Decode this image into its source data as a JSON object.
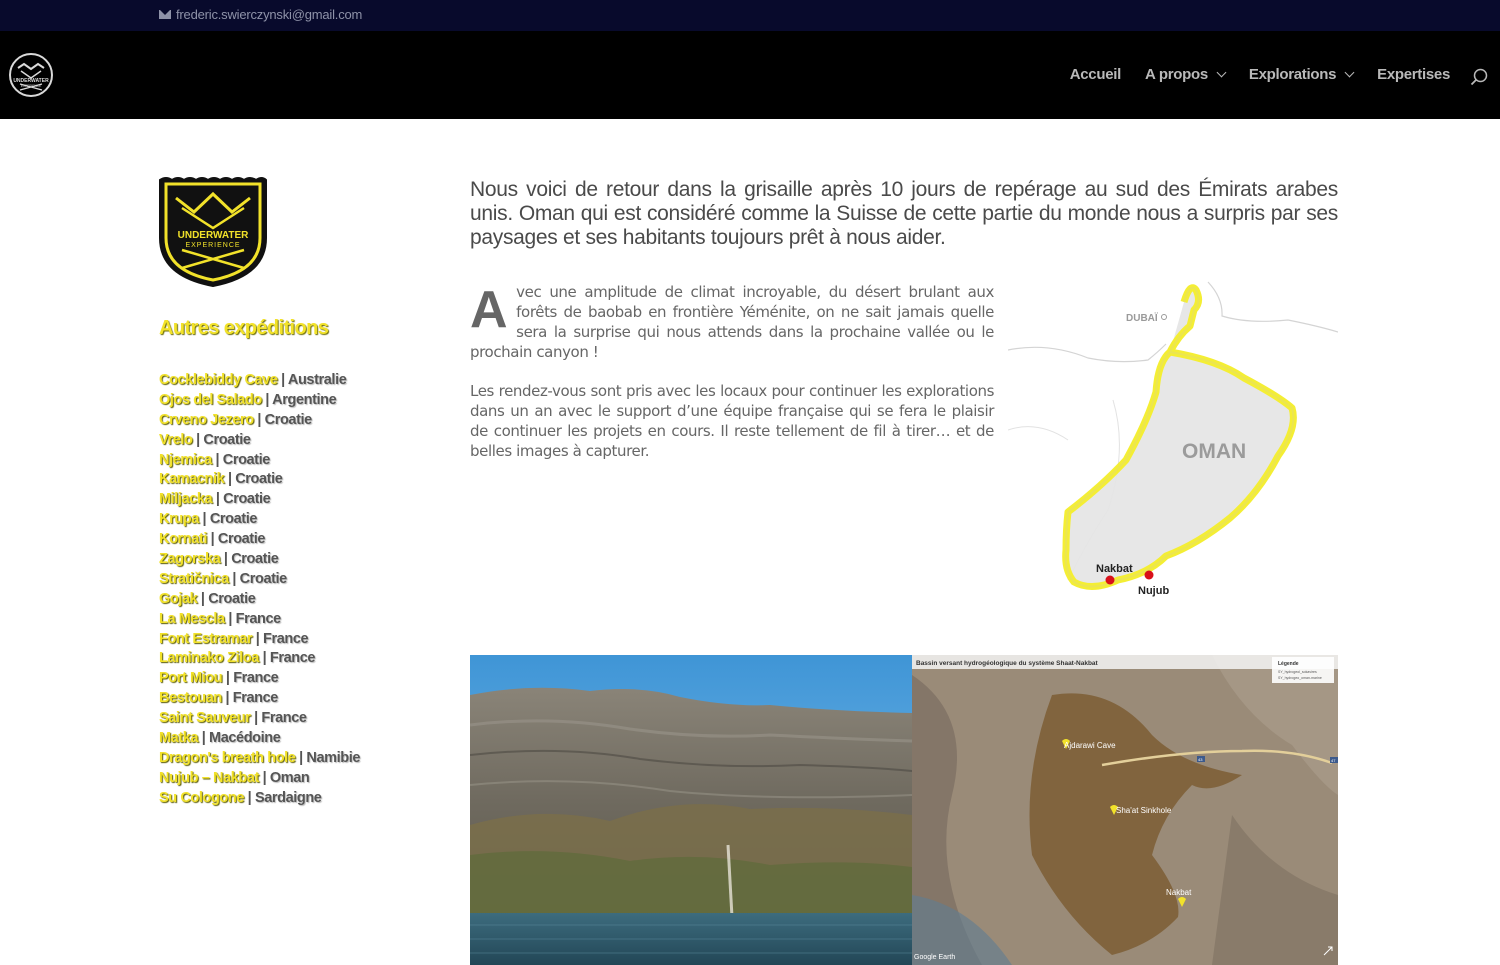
{
  "topbar": {
    "email": "frederic.swierczynski@gmail.com"
  },
  "header": {
    "logo_text_1": "UNDERWATER",
    "logo_text_2": "EXPERIENCE",
    "nav": [
      {
        "label": "Accueil",
        "dropdown": false
      },
      {
        "label": "A propos",
        "dropdown": true
      },
      {
        "label": "Explorations",
        "dropdown": true
      },
      {
        "label": "Expertises",
        "dropdown": false
      }
    ]
  },
  "sidebar": {
    "logo_text_1": "UNDERWATER",
    "logo_text_2": "EXPERIENCE",
    "title": "Autres expéditions",
    "expeditions": [
      {
        "name": "Cocklebiddy Cave",
        "country": "Australie"
      },
      {
        "name": "Ojos del Salado",
        "country": "Argentine"
      },
      {
        "name": "Crveno Jezero",
        "country": "Croatie"
      },
      {
        "name": "Vrelo",
        "country": "Croatie"
      },
      {
        "name": "Njemica",
        "country": "Croatie"
      },
      {
        "name": "Kamacnik",
        "country": "Croatie"
      },
      {
        "name": "Miljacka",
        "country": "Croatie"
      },
      {
        "name": "Krupa",
        "country": "Croatie"
      },
      {
        "name": "Kornati",
        "country": "Croatie"
      },
      {
        "name": "Zagorska",
        "country": "Croatie"
      },
      {
        "name": "Stratičnica",
        "country": "Croatie"
      },
      {
        "name": "Gojak",
        "country": "Croatie"
      },
      {
        "name": "La Mescla",
        "country": "France"
      },
      {
        "name": "Font Estramar",
        "country": "France"
      },
      {
        "name": "Laminako Ziloa",
        "country": "France"
      },
      {
        "name": "Port Miou",
        "country": "France"
      },
      {
        "name": "Bestouan",
        "country": "France"
      },
      {
        "name": "Saint Sauveur",
        "country": "France"
      },
      {
        "name": "Matka",
        "country": "Macédoine"
      },
      {
        "name": "Dragon's breath hole",
        "country": "Namibie"
      },
      {
        "name": "Nujub – Nakbat",
        "country": "Oman"
      },
      {
        "name": "Su Cologone",
        "country": "Sardaigne"
      }
    ]
  },
  "main": {
    "lead": "Nous voici de retour dans la grisaille après 10 jours de repérage au sud des Émirats arabes unis. Oman qui est considéré comme la Suisse de cette partie du monde nous a surpris par ses paysages et ses habitants toujours prêt à nous aider.",
    "para1_dropcap": "A",
    "para1_rest": "vec une amplitude de climat incroyable, du désert brulant aux forêts de baobab en frontière Yéménite, on ne sait jamais quelle sera la surprise qui nous attends dans la prochaine vallée ou le prochain canyon !",
    "para2": "Les rendez-vous sont pris avec les locaux pour continuer les explorations dans un an avec le support d’une équipe française qui se fera le plaisir de continuer les projets en cours. Il reste tellement de fil à tirer… et de belles images à capturer."
  },
  "map": {
    "dubai_label": "DUBAÏ",
    "country_label": "OMAN",
    "nakbat_label": "Nakbat",
    "nujub_label": "Nujub",
    "outline_color": "#f4ee2a",
    "marker_color": "#d8101a"
  },
  "satellite": {
    "title": "Bassin versant hydrogéologique du système Shaat-Nakbat",
    "legend_title": "Légende",
    "legend_1": "SY_hydrogeol_sokavires",
    "legend_2": "SY_hydrogeo_oman-marine",
    "pin_1": "Ajdarawi Cave",
    "pin_2": "Sha'at Sinkhole",
    "pin_3": "Nakbat",
    "watermark": "Google Earth",
    "road_1": "43",
    "road_2": "47"
  },
  "colors": {
    "accent_yellow": "#f2e22a",
    "topbar": "#080a2c",
    "header": "#000000"
  }
}
